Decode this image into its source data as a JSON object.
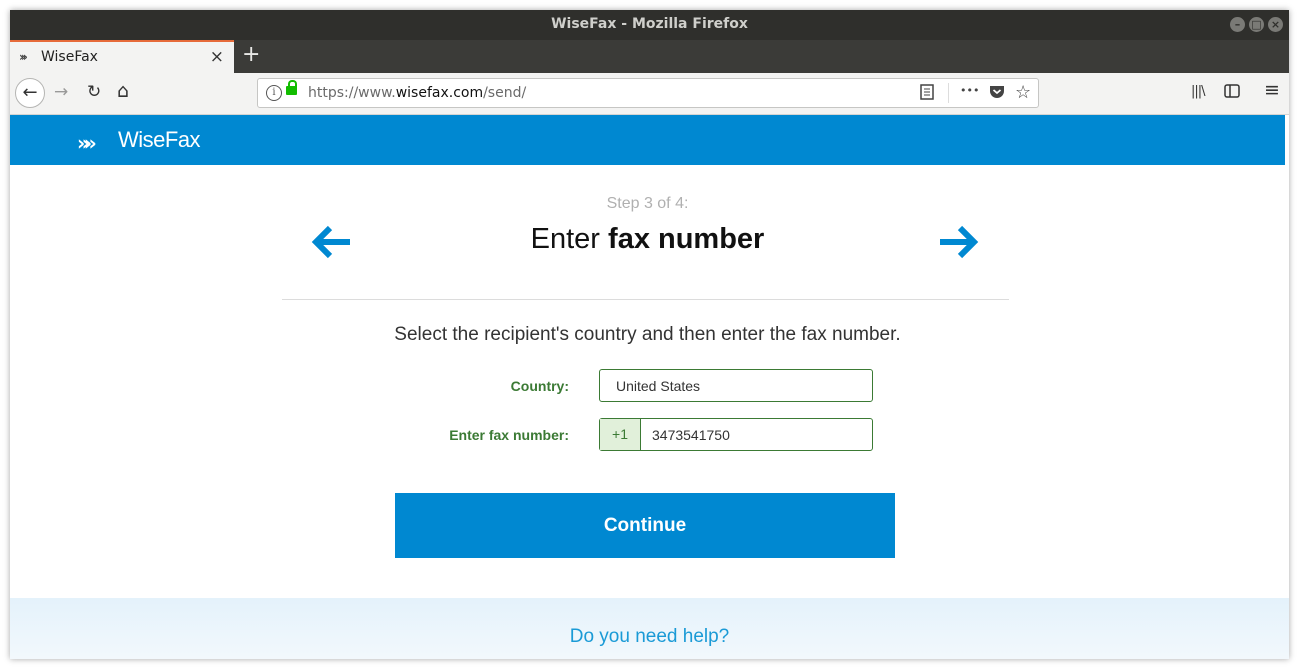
{
  "window": {
    "title": "WiseFax - Mozilla Firefox",
    "controls": [
      "–",
      "□",
      "×"
    ]
  },
  "tabs": {
    "active_title": "WiseFax",
    "close_glyph": "×",
    "new_tab_glyph": "+"
  },
  "navbar": {
    "back_glyph": "←",
    "forward_glyph": "→",
    "reload_glyph": "↻",
    "home_glyph": "⌂",
    "url_scheme": "https://www.",
    "url_host": "wisefax.com",
    "url_path": "/send/",
    "more_glyph": "•••",
    "star_glyph": "☆",
    "library_glyph": "|||\\",
    "menu_glyph": "≡",
    "icons": [
      "info-icon",
      "lock-icon",
      "reader-view-icon",
      "page-actions-icon",
      "pocket-icon",
      "bookmark-star-icon",
      "library-icon",
      "sidebar-icon",
      "hamburger-menu-icon"
    ]
  },
  "header": {
    "logo_mark": "»»",
    "logo_text": "WiseFax",
    "color": "#0088d1"
  },
  "wizard": {
    "step_text": "Step 3 of 4:",
    "heading_prefix": "Enter",
    "heading_bold": "fax number",
    "instruction": "Select the recipient's country and then enter the fax number.",
    "country_label": "Country:",
    "country_value": "United States",
    "fax_label": "Enter fax number:",
    "fax_prefix": "+1",
    "fax_value": "3473541750",
    "continue_label": "Continue",
    "label_color": "#3b7a34"
  },
  "footer": {
    "help_text": "Do you need help?"
  }
}
